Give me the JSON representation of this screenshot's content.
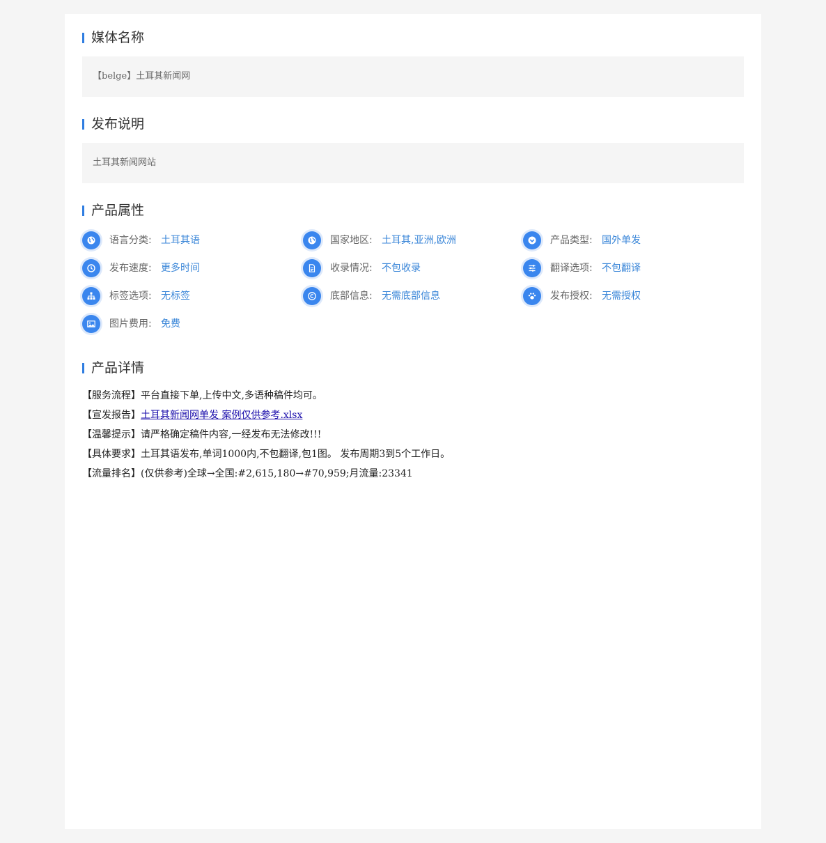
{
  "media_name": {
    "title": "媒体名称",
    "value": "【belge】土耳其新闻网"
  },
  "publish_desc": {
    "title": "发布说明",
    "value": "土耳其新闻网站"
  },
  "attributes": {
    "title": "产品属性",
    "items": [
      {
        "label": "语言分类:",
        "value": "土耳其语",
        "icon": "globe-icon"
      },
      {
        "label": "国家地区:",
        "value": "土耳其,亚洲,欧洲",
        "icon": "globe-icon"
      },
      {
        "label": "产品类型:",
        "value": "国外单发",
        "icon": "chevron-down-icon"
      },
      {
        "label": "发布速度:",
        "value": "更多时间",
        "icon": "clock-icon"
      },
      {
        "label": "收录情况:",
        "value": "不包收录",
        "icon": "document-icon"
      },
      {
        "label": "翻译选项:",
        "value": "不包翻译",
        "icon": "sliders-icon"
      },
      {
        "label": "标签选项:",
        "value": "无标签",
        "icon": "sitemap-icon"
      },
      {
        "label": "底部信息:",
        "value": "无需底部信息",
        "icon": "copyright-icon"
      },
      {
        "label": "发布授权:",
        "value": "无需授权",
        "icon": "paw-icon"
      },
      {
        "label": "图片费用:",
        "value": "免费",
        "icon": "image-icon"
      }
    ]
  },
  "details": {
    "title": "产品详情",
    "line1": "【服务流程】平台直接下单,上传中文,多语种稿件均可。",
    "line2_prefix": "【宣发报告】",
    "line2_link": "土耳其新闻网单发 案例仅供参考.xlsx",
    "line3": "【温馨提示】请严格确定稿件内容,一经发布无法修改!!!",
    "line4": "【具体要求】土耳其语发布,单词1000内,不包翻译,包1图。 发布周期3到5个工作日。",
    "line5": "【流量排名】(仅供参考)全球→全国:#2,615,180→#70,959;月流量:23341"
  },
  "colors": {
    "accent": "#2f7de1",
    "icon_bg": "#3a86ee",
    "value_text": "#3a86d8",
    "link": "#1a0dab"
  }
}
